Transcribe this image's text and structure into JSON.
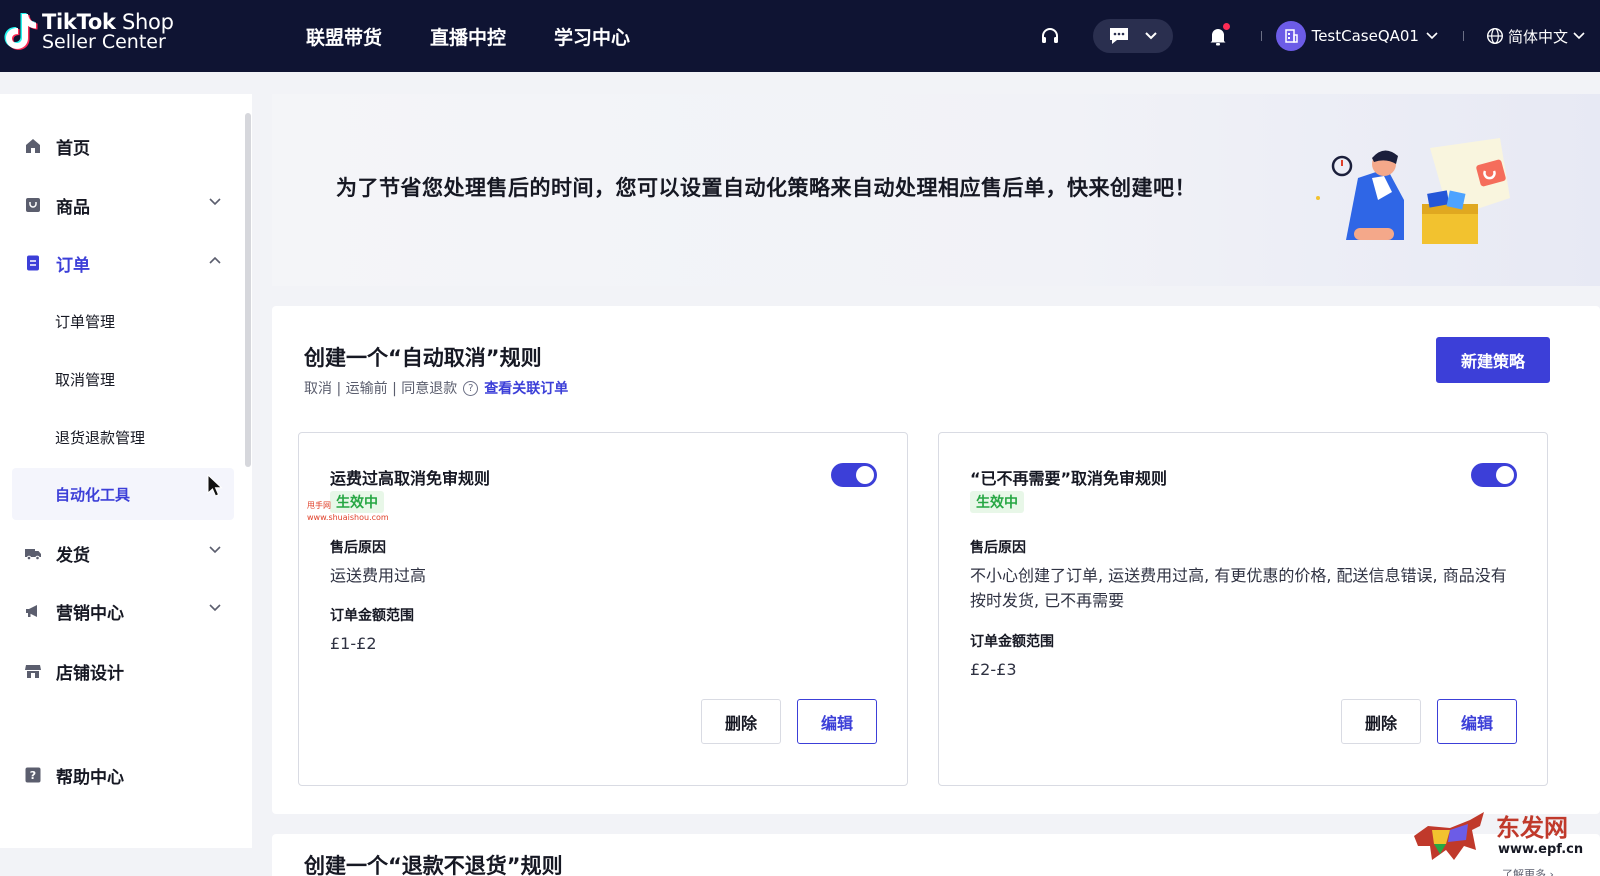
{
  "header": {
    "logo_line1_bold": "TikTok",
    "logo_line1_regular": " Shop",
    "logo_line2": "Seller Center",
    "nav": [
      "联盟带货",
      "直播中控",
      "学习中心"
    ],
    "account_name": "TestCaseQA01",
    "language": "简体中文"
  },
  "sidebar": {
    "items": [
      {
        "label": "首页"
      },
      {
        "label": "商品"
      },
      {
        "label": "订单"
      },
      {
        "label": "发货"
      },
      {
        "label": "营销中心"
      },
      {
        "label": "店铺设计"
      },
      {
        "label": "帮助中心"
      }
    ],
    "order_sub": [
      "订单管理",
      "取消管理",
      "退货退款管理",
      "自动化工具"
    ]
  },
  "banner": {
    "text": "为了节省您处理售后的时间，您可以设置自动化策略来自动处理相应售后单，快来创建吧！"
  },
  "section": {
    "title": "创建一个“自动取消”规则",
    "subtitle": "取消 | 运输前 | 同意退款",
    "help_glyph": "?",
    "link": "查看关联订单",
    "new_button": "新建策略"
  },
  "rules": [
    {
      "title": "运费过高取消免审规则",
      "status": "生效中",
      "reason_label": "售后原因",
      "reason_value": "运送费用过高",
      "amount_label": "订单金额范围",
      "amount_value": "£1-£2",
      "delete_label": "删除",
      "edit_label": "编辑"
    },
    {
      "title": "“已不再需要”取消免审规则",
      "status": "生效中",
      "reason_label": "售后原因",
      "reason_value": "不小心创建了订单, 运送费用过高, 有更优惠的价格, 配送信息错误, 商品没有按时发货, 已不再需要",
      "amount_label": "订单金额范围",
      "amount_value": "£2-£3",
      "delete_label": "删除",
      "edit_label": "编辑"
    }
  ],
  "next_section_title": "创建一个“退款不退货”规则",
  "watermark": {
    "small_line1": "甩手网",
    "small_line2": "www.shuaishou.com",
    "corner_title": "东发网",
    "corner_url": "www.epf.cn",
    "corner_more": "了解更多 ›"
  },
  "colors": {
    "topbar": "#0f1433",
    "primary": "#3c3fd8",
    "success": "#27a744",
    "success_bg": "#e8f7e8"
  }
}
